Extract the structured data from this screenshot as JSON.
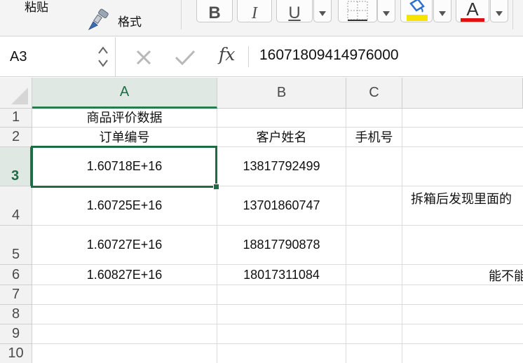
{
  "ribbon": {
    "paste_label": "粘贴",
    "format_label": "格式",
    "bold": "B",
    "italic": "I",
    "underline": "U",
    "font_color_glyph": "A",
    "highlight_color": "#f5e400",
    "font_color": "#e01010"
  },
  "formula_bar": {
    "cell_ref": "A3",
    "fx_label": "fx",
    "value": "16071809414976000"
  },
  "columns": [
    "A",
    "B",
    "C"
  ],
  "rows": [
    {
      "num": "1",
      "a": "商品评价数据",
      "b": "",
      "c": ""
    },
    {
      "num": "2",
      "a": "订单编号",
      "b": "客户姓名",
      "c": "手机号"
    },
    {
      "num": "3",
      "a": "1.60718E+16",
      "b": "13817792499",
      "c": ""
    },
    {
      "num": "4",
      "a": "1.60725E+16",
      "b": "13701860747",
      "c": ""
    },
    {
      "num": "5",
      "a": "1.60727E+16",
      "b": "18817790878",
      "c": ""
    },
    {
      "num": "6",
      "a": "1.60827E+16",
      "b": "18017311084",
      "c": ""
    },
    {
      "num": "7",
      "a": "",
      "b": "",
      "c": ""
    },
    {
      "num": "8",
      "a": "",
      "b": "",
      "c": ""
    },
    {
      "num": "9",
      "a": "",
      "b": "",
      "c": ""
    },
    {
      "num": "10",
      "a": "",
      "b": "",
      "c": ""
    }
  ],
  "overflow": {
    "row4_text": "拆箱后发现里面的",
    "row6_text": "能不能"
  },
  "selected": {
    "column": "A",
    "row": "3"
  }
}
